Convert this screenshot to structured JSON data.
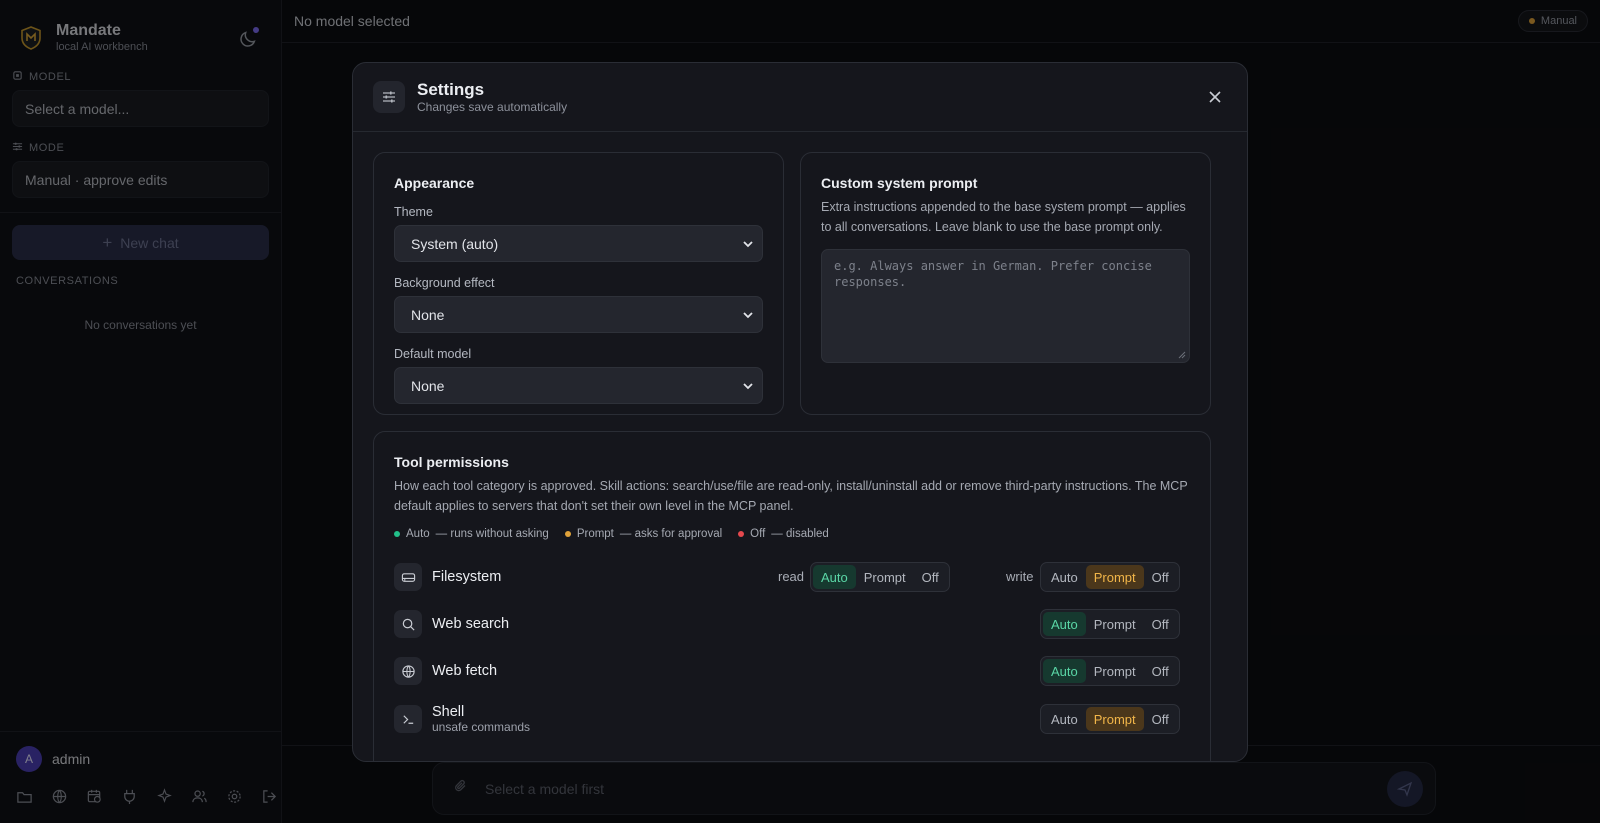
{
  "sidebar": {
    "brand_name": "Mandate",
    "brand_sub": "local AI workbench",
    "model_label": "MODEL",
    "model_value": "Select a model...",
    "mode_label": "MODE",
    "mode_value": "Manual · approve edits",
    "new_chat": "New chat",
    "conversations_label": "CONVERSATIONS",
    "conversations_empty": "No conversations yet",
    "user_initial": "A",
    "user_name": "admin"
  },
  "topbar": {
    "title": "No model selected",
    "mode_pill": "Manual"
  },
  "composer": {
    "placeholder": "Select a model first"
  },
  "settings": {
    "title": "Settings",
    "subtitle": "Changes save automatically",
    "appearance": {
      "title": "Appearance",
      "theme_label": "Theme",
      "theme_value": "System (auto)",
      "bg_label": "Background effect",
      "bg_value": "None",
      "default_model_label": "Default model",
      "default_model_value": "None"
    },
    "custom_prompt": {
      "title": "Custom system prompt",
      "desc": "Extra instructions appended to the base system prompt — applies to all conversations. Leave blank to use the base prompt only.",
      "placeholder": "e.g. Always answer in German. Prefer concise responses."
    },
    "tools": {
      "title": "Tool permissions",
      "desc": "How each tool category is approved. Skill actions: search/use/file are read-only, install/uninstall add or remove third-party instructions. The MCP default applies to servers that don't set their own level in the MCP panel.",
      "legend": [
        {
          "label": "Auto",
          "desc": "— runs without asking",
          "color": "#22c08a"
        },
        {
          "label": "Prompt",
          "desc": "— asks for approval",
          "color": "#e0a23a"
        },
        {
          "label": "Off",
          "desc": "— disabled",
          "color": "#e5484d"
        }
      ],
      "options": [
        "Auto",
        "Prompt",
        "Off"
      ],
      "read_label": "read",
      "write_label": "write",
      "rows": [
        {
          "name": "Filesystem",
          "sub": "",
          "icon": "drive-icon",
          "read": "Auto",
          "write": "Prompt"
        },
        {
          "name": "Web search",
          "sub": "",
          "icon": "search-icon",
          "value": "Auto"
        },
        {
          "name": "Web fetch",
          "sub": "",
          "icon": "globe-icon",
          "value": "Auto"
        },
        {
          "name": "Shell",
          "sub": "unsafe commands",
          "icon": "terminal-icon",
          "value": "Prompt"
        }
      ]
    }
  }
}
